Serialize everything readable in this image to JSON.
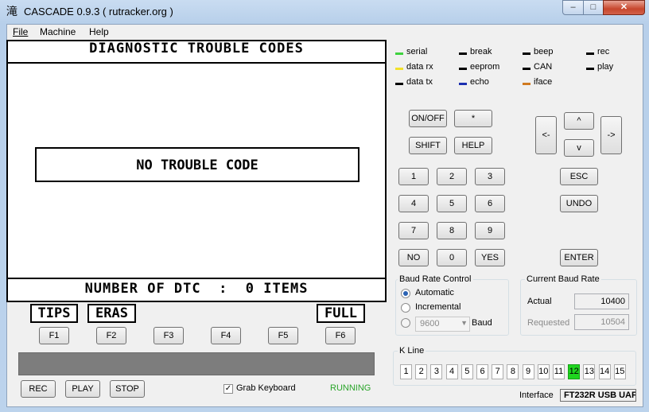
{
  "window": {
    "app_icon": "滝",
    "title": "CASCADE 0.9.3 ( rutracker.org )",
    "caption": {
      "min": "–",
      "max": "□",
      "close": "✕"
    }
  },
  "menu": [
    "File",
    "Machine",
    "Help"
  ],
  "lcd": {
    "title": "DIAGNOSTIC TROUBLE CODES",
    "message": "NO TROUBLE CODE",
    "footer": "NUMBER OF DTC  :  0 ITEMS",
    "softkeys": [
      "TIPS",
      "ERAS",
      "FULL"
    ]
  },
  "function_keys": [
    "F1",
    "F2",
    "F3",
    "F4",
    "F5",
    "F6"
  ],
  "bottom_controls": {
    "rec": "REC",
    "play": "PLAY",
    "stop": "STOP",
    "grab_keyboard": "Grab Keyboard",
    "grab_keyboard_checked": true,
    "status": "RUNNING",
    "status_color": "#2aa52a"
  },
  "indicators": [
    {
      "label": "serial",
      "color": "#3fd23f"
    },
    {
      "label": "break",
      "color": "#000000"
    },
    {
      "label": "beep",
      "color": "#000000"
    },
    {
      "label": "rec",
      "color": "#000000"
    },
    {
      "label": "data rx",
      "color": "#f2e12a"
    },
    {
      "label": "eeprom",
      "color": "#000000"
    },
    {
      "label": "CAN",
      "color": "#000000"
    },
    {
      "label": "play",
      "color": "#000000"
    },
    {
      "label": "data tx",
      "color": "#000000"
    },
    {
      "label": "echo",
      "color": "#1c2fb0"
    },
    {
      "label": "iface",
      "color": "#d07a20"
    }
  ],
  "keypad": {
    "onoff": "ON/OFF",
    "star": "*",
    "shift": "SHIFT",
    "help": "HELP",
    "left": "<-",
    "up": "^",
    "down": "v",
    "right": "->",
    "digits": [
      "1",
      "2",
      "3",
      "4",
      "5",
      "6",
      "7",
      "8",
      "9"
    ],
    "no": "NO",
    "zero": "0",
    "yes": "YES",
    "esc": "ESC",
    "undo": "UNDO",
    "enter": "ENTER"
  },
  "baud_control": {
    "title": "Baud Rate Control",
    "automatic": "Automatic",
    "incremental": "Incremental",
    "select_value": "9600",
    "baud_label": "Baud",
    "selected": "automatic"
  },
  "current_baud": {
    "title": "Current Baud Rate",
    "actual_label": "Actual",
    "actual_value": "10400",
    "requested_label": "Requested",
    "requested_value": "10504"
  },
  "kline": {
    "title": "K Line",
    "items": [
      "1",
      "2",
      "3",
      "4",
      "5",
      "6",
      "7",
      "8",
      "9",
      "10",
      "11",
      "12",
      "13",
      "14",
      "15"
    ],
    "active": "12"
  },
  "interface": {
    "label": "Interface",
    "value": "FT232R USB UAF"
  }
}
